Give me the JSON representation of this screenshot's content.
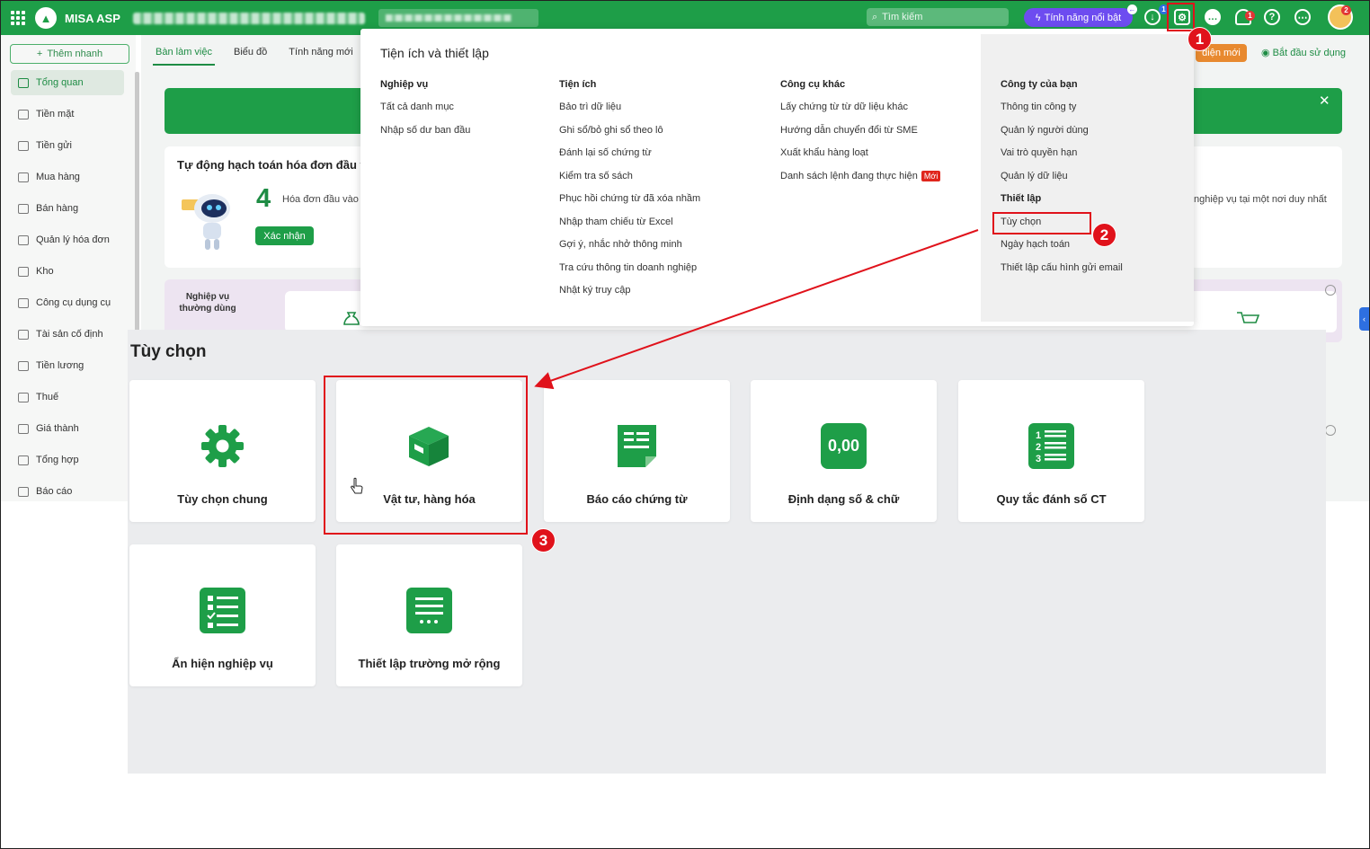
{
  "topbar": {
    "app_title": "MISA ASP",
    "search_placeholder": "Tìm kiếm",
    "feature_label": "Tính năng nổi bật",
    "notif_count": "1",
    "avatar_count": "2",
    "download_count": "1",
    "brand_color": "#1e9e48"
  },
  "sidebar": {
    "quick_add": "Thêm nhanh",
    "items": [
      {
        "label": "Tổng quan",
        "icon": "grid-icon"
      },
      {
        "label": "Tiền mặt",
        "icon": "cash-icon"
      },
      {
        "label": "Tiền gửi",
        "icon": "bank-icon"
      },
      {
        "label": "Mua hàng",
        "icon": "bag-icon"
      },
      {
        "label": "Bán hàng",
        "icon": "cart-icon"
      },
      {
        "label": "Quản lý hóa đơn",
        "icon": "invoice-icon"
      },
      {
        "label": "Kho",
        "icon": "warehouse-icon"
      },
      {
        "label": "Công cụ dụng cụ",
        "icon": "tools-icon"
      },
      {
        "label": "Tài sản cố định",
        "icon": "truck-icon"
      },
      {
        "label": "Tiền lương",
        "icon": "salary-icon"
      },
      {
        "label": "Thuế",
        "icon": "tax-icon"
      },
      {
        "label": "Giá thành",
        "icon": "cost-icon"
      },
      {
        "label": "Tổng hợp",
        "icon": "summary-icon"
      },
      {
        "label": "Báo cáo",
        "icon": "report-icon"
      }
    ]
  },
  "main": {
    "tabs": [
      "Bàn làm việc",
      "Biểu đồ",
      "Tính năng mới"
    ],
    "new_ui": "diện mới",
    "start_use": "Bắt đầu sử dụng",
    "auto_title": "Tự động hạch toán hóa đơn đầu v",
    "invoice_count": "4",
    "invoice_desc": "Hóa đơn đầu vào c",
    "confirm_btn": "Xác nhận",
    "right_desc": "nghiệp vụ tại một nơi duy nhất",
    "ops_label": "Nghiệp vụ thường dùng"
  },
  "dropdown": {
    "title": "Tiện ích và thiết lập",
    "col1": {
      "head": "Nghiệp vụ",
      "links": [
        "Tất cả danh mục",
        "Nhập số dư ban đầu"
      ]
    },
    "col2": {
      "head": "Tiện ích",
      "links": [
        "Bảo trì dữ liệu",
        "Ghi sổ/bỏ ghi sổ theo lô",
        "Đánh lại số chứng từ",
        "Kiểm tra số sách",
        "Phục hồi chứng từ đã xóa nhầm",
        "Nhập tham chiếu từ Excel",
        "Gợi ý, nhắc nhở thông minh",
        "Tra cứu thông tin doanh nghiệp",
        "Nhật ký truy cập"
      ]
    },
    "col3": {
      "head": "Công cụ khác",
      "links": [
        "Lấy chứng từ từ dữ liệu khác",
        "Hướng dẫn chuyển đổi từ SME",
        "Xuất khẩu hàng loạt",
        "Danh sách lệnh đang thực hiện"
      ],
      "new_tag": "Mới"
    },
    "col4": {
      "head": "Công ty của bạn",
      "links": [
        "Thông tin công ty",
        "Quản lý người dùng",
        "Vai trò quyền hạn",
        "Quản lý dữ liệu"
      ],
      "head2": "Thiết lập",
      "links2": [
        "Tùy chọn",
        "Ngày hạch toán",
        "Thiết lập cấu hình gửi email"
      ]
    }
  },
  "options": {
    "title": "Tùy chọn",
    "cards": [
      {
        "label": "Tùy chọn chung",
        "icon": "gear-icon"
      },
      {
        "label": "Vật tư, hàng hóa",
        "icon": "box-icon"
      },
      {
        "label": "Báo cáo chứng từ",
        "icon": "document-icon"
      },
      {
        "label": "Định dạng số & chữ",
        "icon": "number-format-icon",
        "icon_text": "0,00"
      },
      {
        "label": "Quy tắc đánh số CT",
        "icon": "numbered-list-icon"
      },
      {
        "label": "Ẩn hiện nghiệp vụ",
        "icon": "checklist-icon"
      },
      {
        "label": "Thiết lập trường mở rộng",
        "icon": "form-fields-icon"
      }
    ]
  },
  "annotations": {
    "steps": [
      "1",
      "2",
      "3"
    ],
    "color": "#e0121b"
  }
}
